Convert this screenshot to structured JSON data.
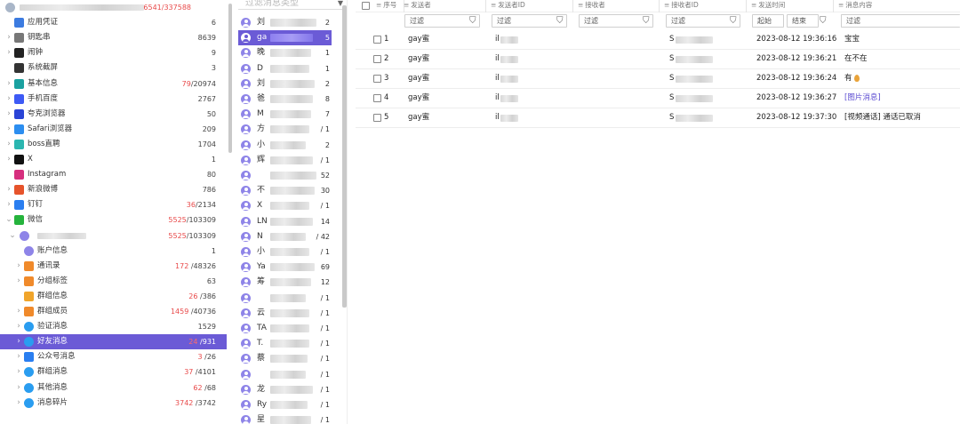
{
  "tree": {
    "root_count": "6541/337588",
    "items": [
      {
        "label": "应用凭证",
        "count": "6",
        "icon": "app-credential-icon",
        "color": "#3c7be0",
        "depth": 1,
        "arrow": ""
      },
      {
        "label": "钥匙串",
        "count": "8639",
        "icon": "keychain-icon",
        "color": "#777777",
        "depth": 1,
        "arrow": ">"
      },
      {
        "label": "闹钟",
        "count": "9",
        "icon": "alarm-clock-icon",
        "color": "#222222",
        "depth": 1,
        "arrow": ">"
      },
      {
        "label": "系统截屏",
        "count": "3",
        "icon": "screenshot-icon",
        "color": "#333333",
        "depth": 1,
        "arrow": ""
      },
      {
        "label": "基本信息",
        "count_red": "79",
        "count_rest": "/20974",
        "icon": "basic-info-icon",
        "color": "#1aa1a0",
        "depth": 1,
        "arrow": ">"
      },
      {
        "label": "手机百度",
        "count": "2767",
        "icon": "baidu-icon",
        "color": "#3d5af5",
        "depth": 1,
        "arrow": ">"
      },
      {
        "label": "夸克浏览器",
        "count": "50",
        "icon": "quark-browser-icon",
        "color": "#2a44d6",
        "depth": 1,
        "arrow": ">"
      },
      {
        "label": "Safari浏览器",
        "count": "209",
        "icon": "safari-icon",
        "color": "#2c8ef0",
        "depth": 1,
        "arrow": ">"
      },
      {
        "label": "boss直聘",
        "count": "1704",
        "icon": "boss-icon",
        "color": "#2bb6b0",
        "depth": 1,
        "arrow": ">"
      },
      {
        "label": "X",
        "count": "1",
        "icon": "x-icon",
        "color": "#111111",
        "depth": 1,
        "arrow": ">"
      },
      {
        "label": "Instagram",
        "count": "80",
        "icon": "instagram-icon",
        "color": "#d62f7e",
        "depth": 1,
        "arrow": ""
      },
      {
        "label": "新浪微博",
        "count": "786",
        "icon": "weibo-icon",
        "color": "#e6532b",
        "depth": 1,
        "arrow": ">"
      },
      {
        "label": "钉钉",
        "count_red": "36",
        "count_rest": "/2134",
        "icon": "dingtalk-icon",
        "color": "#2a7ef0",
        "depth": 1,
        "arrow": ">"
      },
      {
        "label": "微信",
        "count_red": "5525",
        "count_rest": "/103309",
        "icon": "wechat-icon",
        "color": "#25b33c",
        "depth": 1,
        "arrow": "v"
      },
      {
        "label": "",
        "count_red": "5525",
        "count_rest": "/103309",
        "icon": "user-avatar-icon",
        "color": "#8e84e8",
        "depth": 2,
        "arrow": "v",
        "blur": true
      },
      {
        "label": "账户信息",
        "count": "1",
        "icon": "account-icon",
        "color": "#8e84e8",
        "depth": 3,
        "arrow": ""
      },
      {
        "label": "通讯录",
        "count_red": "172",
        "count_rest": " /48326",
        "icon": "contacts-icon",
        "color": "#f08a2b",
        "depth": 3,
        "arrow": ">"
      },
      {
        "label": "分组标签",
        "count": "63",
        "icon": "group-tag-icon",
        "color": "#f08a2b",
        "depth": 3,
        "arrow": ">"
      },
      {
        "label": "群组信息",
        "count_red": "26",
        "count_rest": " /386",
        "icon": "group-info-icon",
        "color": "#f0a52b",
        "depth": 3,
        "arrow": ""
      },
      {
        "label": "群组成员",
        "count_red": "1459",
        "count_rest": " /40736",
        "icon": "group-member-icon",
        "color": "#f08a2b",
        "depth": 3,
        "arrow": ">"
      },
      {
        "label": "验证消息",
        "count": "1529",
        "icon": "verify-message-icon",
        "color": "#2a9df0",
        "depth": 3,
        "arrow": ">"
      },
      {
        "label": "好友消息",
        "count_red": "24",
        "count_rest": " /931",
        "icon": "friend-message-icon",
        "color": "#2a9df0",
        "depth": 3,
        "arrow": ">",
        "selected": true
      },
      {
        "label": "公众号消息",
        "count_red": "3",
        "count_rest": " /26",
        "icon": "official-account-icon",
        "color": "#2a7ef0",
        "depth": 3,
        "arrow": ">"
      },
      {
        "label": "群组消息",
        "count_red": "37",
        "count_rest": " /4101",
        "icon": "group-message-icon",
        "color": "#2a9df0",
        "depth": 3,
        "arrow": ">"
      },
      {
        "label": "其他消息",
        "count_red": "62",
        "count_rest": " /68",
        "icon": "other-message-icon",
        "color": "#2a9df0",
        "depth": 3,
        "arrow": ">"
      },
      {
        "label": "消息碎片",
        "count_red": "3742",
        "count_rest": " /3742",
        "icon": "message-fragment-icon",
        "color": "#2a9df0",
        "depth": 3,
        "arrow": ">"
      }
    ]
  },
  "contacts": {
    "msg_type_placeholder": "过滤消息类型",
    "items": [
      {
        "name": "刘",
        "count": "2"
      },
      {
        "name": "ga",
        "count": "5",
        "selected": true
      },
      {
        "name": "晚",
        "count": "1"
      },
      {
        "name": "D",
        "count": "1"
      },
      {
        "name": "刘",
        "count": "2"
      },
      {
        "name": "爸",
        "count": "8"
      },
      {
        "name": "M",
        "count": "7"
      },
      {
        "name": "方",
        "count": "/ 1"
      },
      {
        "name": "小",
        "count": "2"
      },
      {
        "name": "辉",
        "count": "/ 1"
      },
      {
        "name": "",
        "count": "52"
      },
      {
        "name": "不",
        "count": "30"
      },
      {
        "name": "X",
        "count": "/ 1"
      },
      {
        "name": "LN",
        "count": "14"
      },
      {
        "name": "N",
        "count": "/ 42"
      },
      {
        "name": "小",
        "count": "/ 1"
      },
      {
        "name": "Ya",
        "count": "69"
      },
      {
        "name": "筹",
        "count": "12"
      },
      {
        "name": "",
        "count": "/ 1"
      },
      {
        "name": "云",
        "count": "/ 1"
      },
      {
        "name": "TA",
        "count": "/ 1"
      },
      {
        "name": "T.",
        "count": "/ 1"
      },
      {
        "name": "蔡",
        "count": "/ 1"
      },
      {
        "name": "",
        "count": "/ 1"
      },
      {
        "name": "龙",
        "count": "/ 1"
      },
      {
        "name": "Ry",
        "count": "/ 1"
      },
      {
        "name": "星",
        "count": "/ 1"
      }
    ]
  },
  "table": {
    "columns": [
      {
        "label": "序号"
      },
      {
        "label": "发送者"
      },
      {
        "label": "发送者ID"
      },
      {
        "label": "接收者"
      },
      {
        "label": "接收者ID"
      },
      {
        "label": "发送时间"
      },
      {
        "label": "消息内容"
      }
    ],
    "filter_label": "过滤",
    "time_start_label": "起始",
    "time_end_label": "结束",
    "rows": [
      {
        "index": "1",
        "sender": "gay蜜",
        "sender_id": "il",
        "receiver_id": "S",
        "time": "2023-08-12 19:36:16",
        "content": "宝宝",
        "link": false,
        "egg": false
      },
      {
        "index": "2",
        "sender": "gay蜜",
        "sender_id": "il",
        "receiver_id": "S",
        "time": "2023-08-12 19:36:21",
        "content": "在不在",
        "link": false,
        "egg": false
      },
      {
        "index": "3",
        "sender": "gay蜜",
        "sender_id": "il",
        "receiver_id": "S",
        "time": "2023-08-12 19:36:24",
        "content": "有",
        "link": false,
        "egg": true
      },
      {
        "index": "4",
        "sender": "gay蜜",
        "sender_id": "il",
        "receiver_id": "S",
        "time": "2023-08-12 19:36:27",
        "content": "[图片消息]",
        "link": true,
        "egg": false
      },
      {
        "index": "5",
        "sender": "gay蜜",
        "sender_id": "il",
        "receiver_id": "S",
        "time": "2023-08-12 19:37:30",
        "content": "[视频通话] 通话已取消",
        "link": false,
        "egg": false
      }
    ]
  }
}
